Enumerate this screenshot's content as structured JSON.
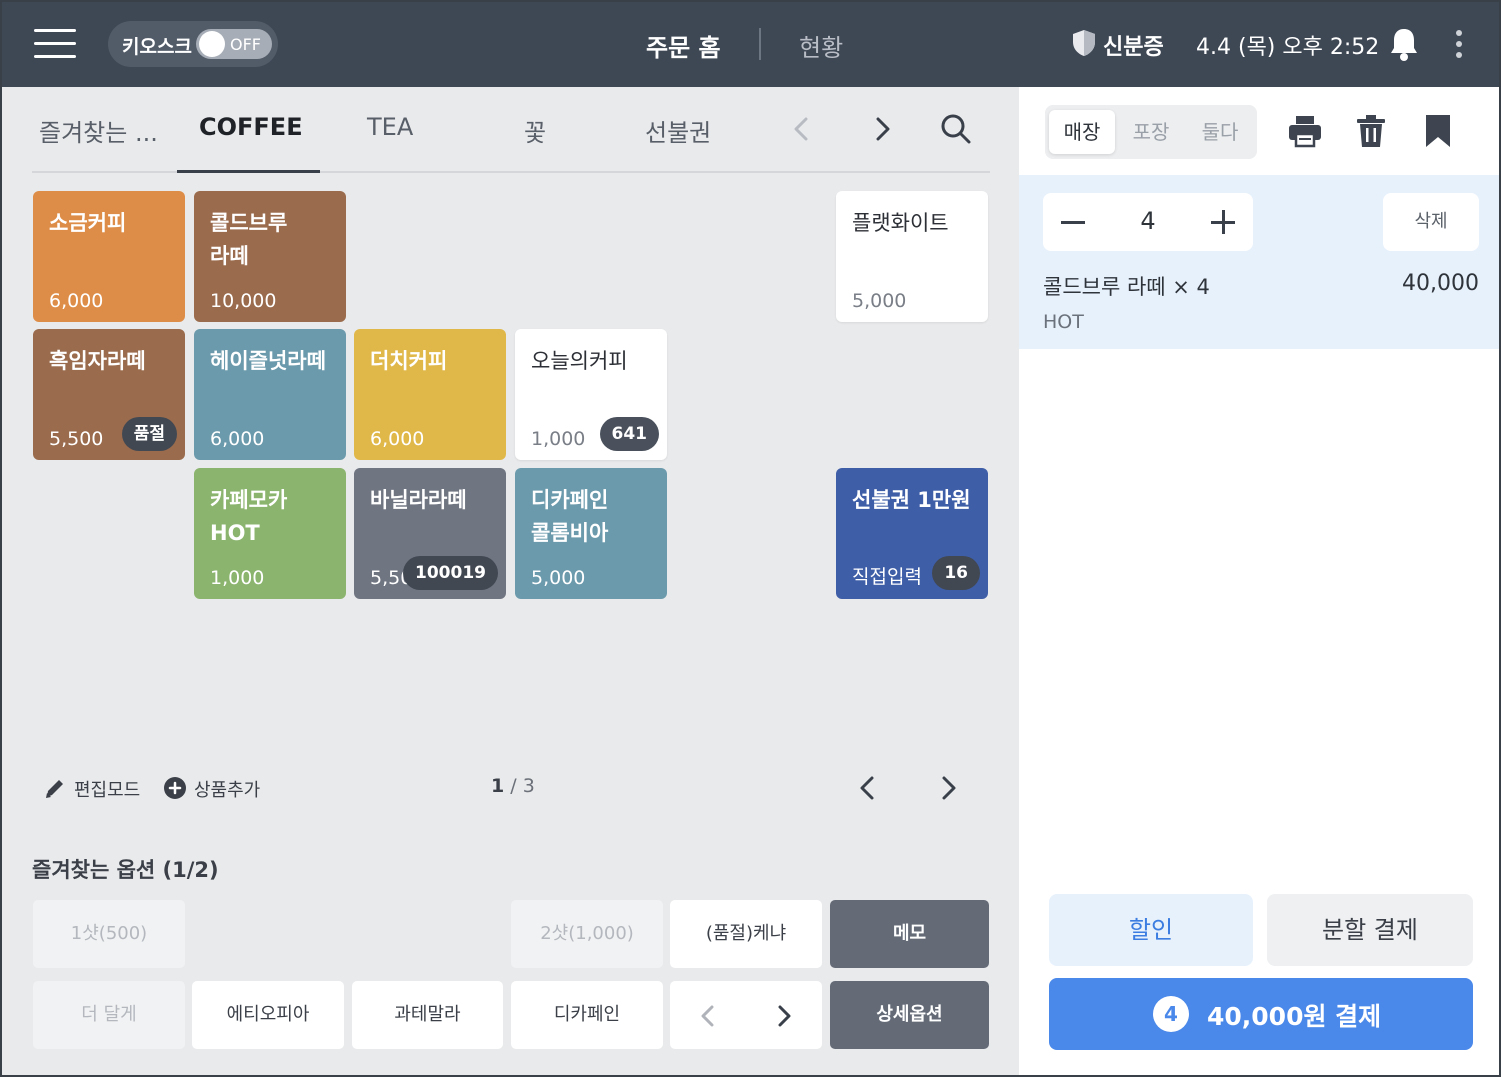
{
  "header": {
    "kiosk_label": "키오스크",
    "kiosk_state": "OFF",
    "nav_home": "주문 홈",
    "nav_status": "현황",
    "id_label": "신분증",
    "datetime": "4.4 (목) 오후 2:52"
  },
  "category_tabs": [
    {
      "label": "즐겨찾는 ...",
      "active": false
    },
    {
      "label": "COFFEE",
      "active": true
    },
    {
      "label": "TEA",
      "active": false
    },
    {
      "label": "꽃",
      "active": false
    },
    {
      "label": "선불권",
      "active": false
    }
  ],
  "products": [
    {
      "name": "소금커피",
      "price": "6,000",
      "badge": "",
      "color": "#de8d48"
    },
    {
      "name": "콜드브루\n라떼",
      "price": "10,000",
      "badge": "",
      "color": "#9a6b4c"
    },
    {
      "name": "플랫화이트",
      "price": "5,000",
      "badge": "",
      "color": "#ffffff"
    },
    {
      "name": "흑임자라떼",
      "price": "5,500",
      "badge": "품절",
      "color": "#9a6b4c"
    },
    {
      "name": "헤이즐넛라떼",
      "price": "6,000",
      "badge": "",
      "color": "#6b9aac"
    },
    {
      "name": "더치커피",
      "price": "6,000",
      "badge": "",
      "color": "#e0b84a"
    },
    {
      "name": "오늘의커피",
      "price": "1,000",
      "badge": "641",
      "color": "#ffffff"
    },
    {
      "name": "카페모카\nHOT",
      "price": "1,000",
      "badge": "",
      "color": "#8bb46e"
    },
    {
      "name": "바닐라라떼",
      "price": "5,50",
      "badge": "100019",
      "color": "#6f7581"
    },
    {
      "name": "디카페인\n콜롬비아",
      "price": "5,000",
      "badge": "",
      "color": "#6b9aac"
    },
    {
      "name": "선불권 1만원",
      "price": "직접입력",
      "badge": "16",
      "color": "#3f5ea8"
    }
  ],
  "grid_footer": {
    "edit_mode": "편집모드",
    "add_product": "상품추가",
    "page_current": "1",
    "page_total": " / 3"
  },
  "favorite_options": {
    "title": "즐겨찾는 옵션 (1/2)",
    "items": [
      {
        "label": "1샷(500)",
        "state": "disabled"
      },
      {
        "label": "2샷(1,000)",
        "state": "disabled"
      },
      {
        "label": "(품절)케냐",
        "state": "normal"
      },
      {
        "label": "메모",
        "state": "dark"
      },
      {
        "label": "더 달게",
        "state": "disabled"
      },
      {
        "label": "에티오피아",
        "state": "normal"
      },
      {
        "label": "과테말라",
        "state": "normal"
      },
      {
        "label": "디카페인",
        "state": "normal"
      },
      {
        "label": "상세옵션",
        "state": "dark"
      }
    ]
  },
  "order_panel": {
    "order_types": [
      {
        "label": "매장",
        "active": true
      },
      {
        "label": "포장",
        "active": false
      },
      {
        "label": "둘다",
        "active": false
      }
    ],
    "items": [
      {
        "quantity": "4",
        "name": "콜드브루 라떼 × 4",
        "total": "40,000",
        "option": "HOT",
        "delete_label": "삭제"
      }
    ],
    "discount_label": "할인",
    "split_label": "분할 결제",
    "pay_count": "4",
    "pay_label": "40,000원 결제"
  },
  "colors": {
    "topbar": "#3e4754",
    "accent_blue": "#4a88ea",
    "order_highlight": "#e7f1fc"
  },
  "icons": [
    "hamburger-icon",
    "shield-icon",
    "bell-icon",
    "more-vertical-icon",
    "chevron-left-icon",
    "chevron-right-icon",
    "search-icon",
    "pencil-icon",
    "plus-circle-icon",
    "printer-icon",
    "trash-icon",
    "bookmark-icon",
    "minus-icon",
    "plus-icon"
  ]
}
